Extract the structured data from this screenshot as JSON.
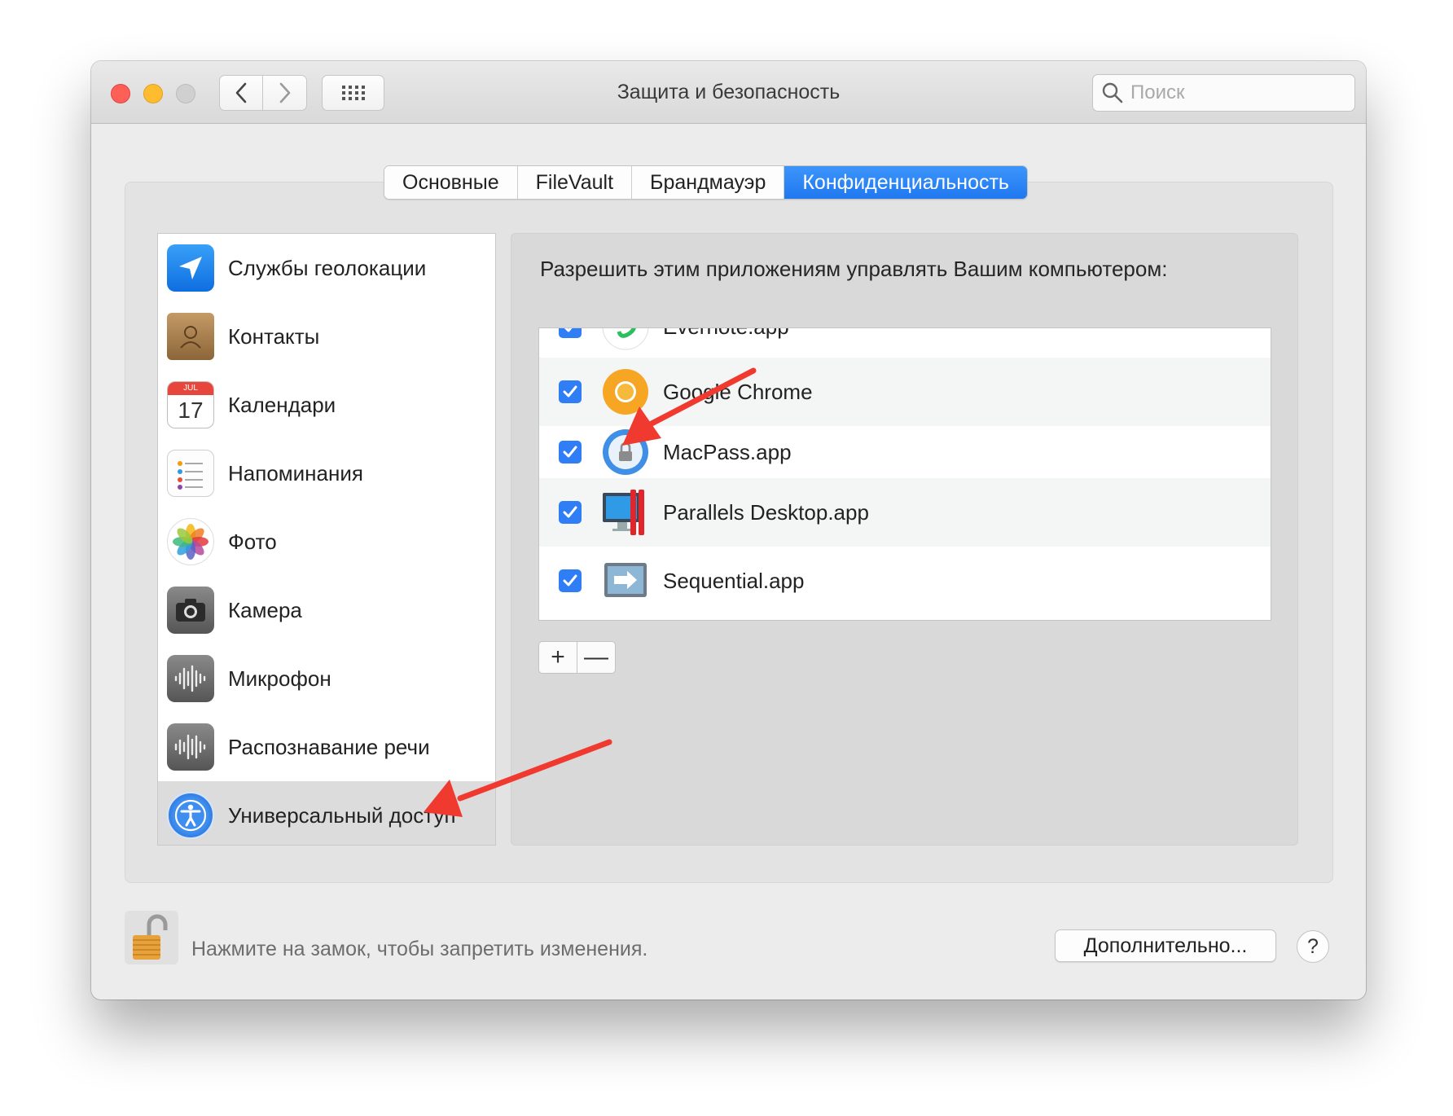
{
  "window": {
    "title": "Защита и безопасность"
  },
  "toolbar": {
    "search_placeholder": "Поиск"
  },
  "tabs": [
    {
      "label": "Основные"
    },
    {
      "label": "FileVault"
    },
    {
      "label": "Брандмауэр"
    },
    {
      "label": "Конфиденциальность"
    }
  ],
  "active_tab": "Конфиденциальность",
  "sidebar": {
    "items": [
      {
        "label": "Службы геолокации",
        "icon": "location-services-icon"
      },
      {
        "label": "Контакты",
        "icon": "contacts-icon"
      },
      {
        "label": "Календари",
        "icon": "calendar-icon"
      },
      {
        "label": "Напоминания",
        "icon": "reminders-icon"
      },
      {
        "label": "Фото",
        "icon": "photos-icon"
      },
      {
        "label": "Камера",
        "icon": "camera-icon"
      },
      {
        "label": "Микрофон",
        "icon": "microphone-icon"
      },
      {
        "label": "Распознавание речи",
        "icon": "speech-recognition-icon"
      },
      {
        "label": "Универсальный доступ",
        "icon": "accessibility-icon"
      }
    ],
    "selected": "Универсальный доступ"
  },
  "calendar_icon": {
    "month": "JUL",
    "day": "17"
  },
  "panel": {
    "description": "Разрешить этим приложениям управлять Вашим компьютером:",
    "apps": [
      {
        "name": "Evernote.app",
        "checked": true,
        "icon": "evernote-icon"
      },
      {
        "name": "Google Chrome",
        "checked": true,
        "icon": "chrome-icon"
      },
      {
        "name": "MacPass.app",
        "checked": true,
        "icon": "macpass-icon"
      },
      {
        "name": "Parallels Desktop.app",
        "checked": true,
        "icon": "parallels-icon"
      },
      {
        "name": "Sequential.app",
        "checked": true,
        "icon": "sequential-icon"
      }
    ],
    "add_label": "+",
    "remove_label": "—"
  },
  "footer": {
    "lock_text": "Нажмите на замок, чтобы запретить изменения.",
    "advanced_label": "Дополнительно...",
    "help_label": "?"
  },
  "colors": {
    "accent": "#1f78f0",
    "annotation_arrow": "#f03a2f"
  }
}
